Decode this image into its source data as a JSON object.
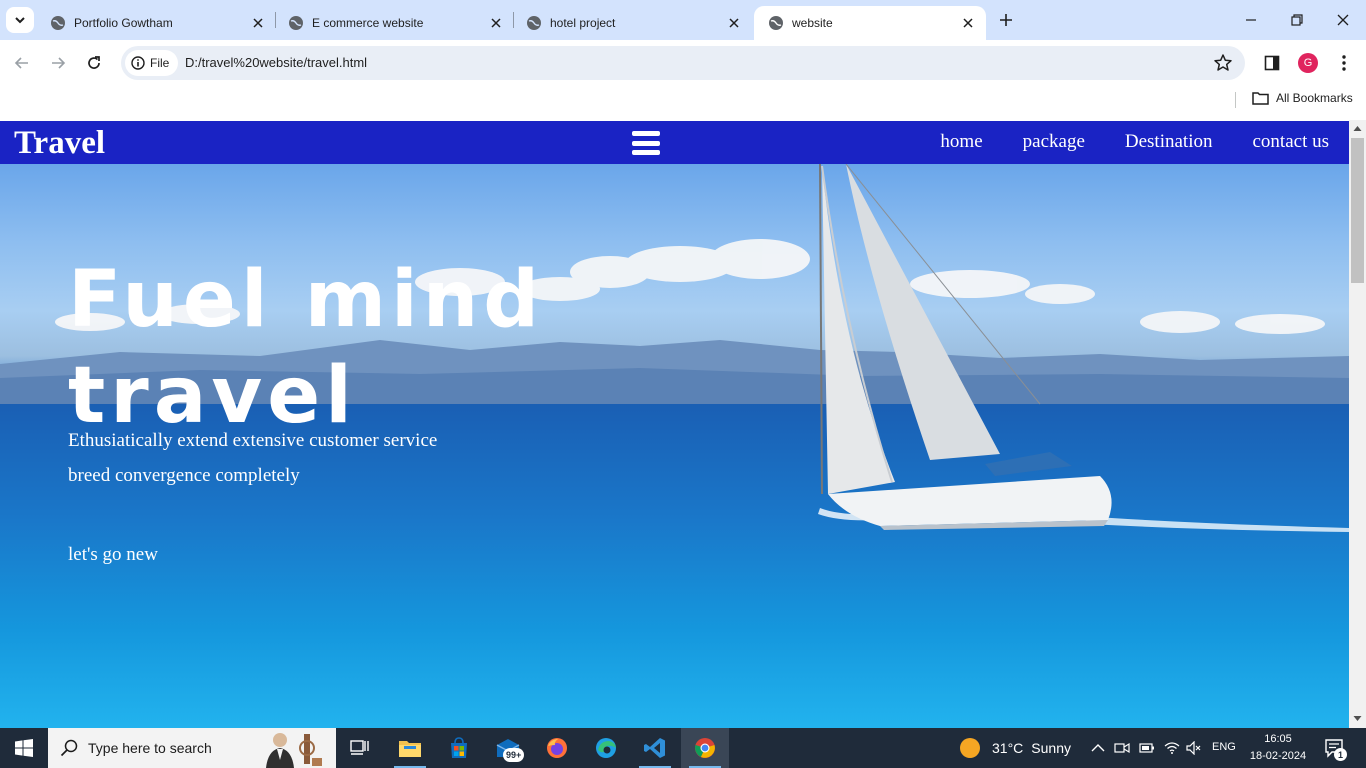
{
  "browser": {
    "tabs": [
      {
        "title": "Portfolio Gowtham",
        "active": false
      },
      {
        "title": "E commerce website",
        "active": false
      },
      {
        "title": "hotel project",
        "active": false
      },
      {
        "title": "website",
        "active": true
      }
    ],
    "site_chip": "File",
    "url": "D:/travel%20website/travel.html",
    "profile_initial": "G",
    "bookmarks_label": "All Bookmarks"
  },
  "page": {
    "brand": "Travel",
    "nav": [
      "home",
      "package",
      "Destination",
      "contact us"
    ],
    "hero": {
      "title_line1": "Fuel mind",
      "title_line2": "travel",
      "sub_line1": "Ethusiatically extend extensive customer service",
      "sub_line2": "breed convergence completely",
      "cta": "let's go new"
    },
    "colors": {
      "nav_bg": "#1a23c4",
      "text": "#ffffff"
    }
  },
  "taskbar": {
    "search_placeholder": "Type here to search",
    "mail_badge": "99+",
    "weather_temp": "31°C",
    "weather_text": "Sunny",
    "language": "ENG",
    "time": "16:05",
    "date": "18-02-2024",
    "notification_count": "1"
  }
}
